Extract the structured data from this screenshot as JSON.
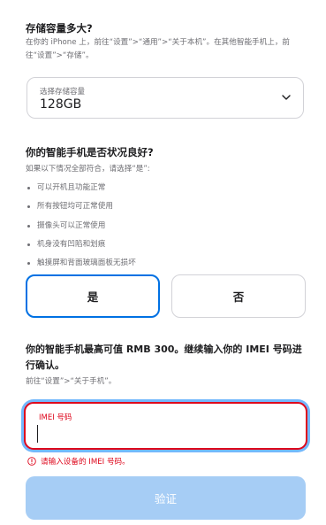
{
  "storage": {
    "question": "存储容量多大?",
    "hint": "在你的 iPhone 上，前往“设置”>“通用”>“关于本机”。在其他智能手机上，前往“设置”>“存储”。",
    "select_caption": "选择存储容量",
    "select_value": "128GB"
  },
  "condition": {
    "question": "你的智能手机是否状况良好?",
    "hint": "如果以下情况全部符合，请选择“是”:",
    "bullets": [
      "可以开机且功能正常",
      "所有按钮均可正常使用",
      "摄像头可以正常使用",
      "机身没有凹陷和划痕",
      "触摸屏和背面玻璃面板无损坏"
    ],
    "yes_label": "是",
    "no_label": "否",
    "selected": "yes"
  },
  "value": {
    "text": "你的智能手机最高可值 RMB 300。继续输入你的 IMEI 号码进行确认。",
    "hint": "前往“设置”>“关于手机”。"
  },
  "imei": {
    "label": "IMEI 号码",
    "value": "",
    "error": "请输入设备的 IMEI 号码。"
  },
  "verify_label": "验证",
  "icons": {
    "dropdown": "chevron-down-icon",
    "error": "error-circle-icon"
  },
  "colors": {
    "accent": "#0071e3",
    "error": "#de071c",
    "disabled_button": "#a6cdf5"
  }
}
